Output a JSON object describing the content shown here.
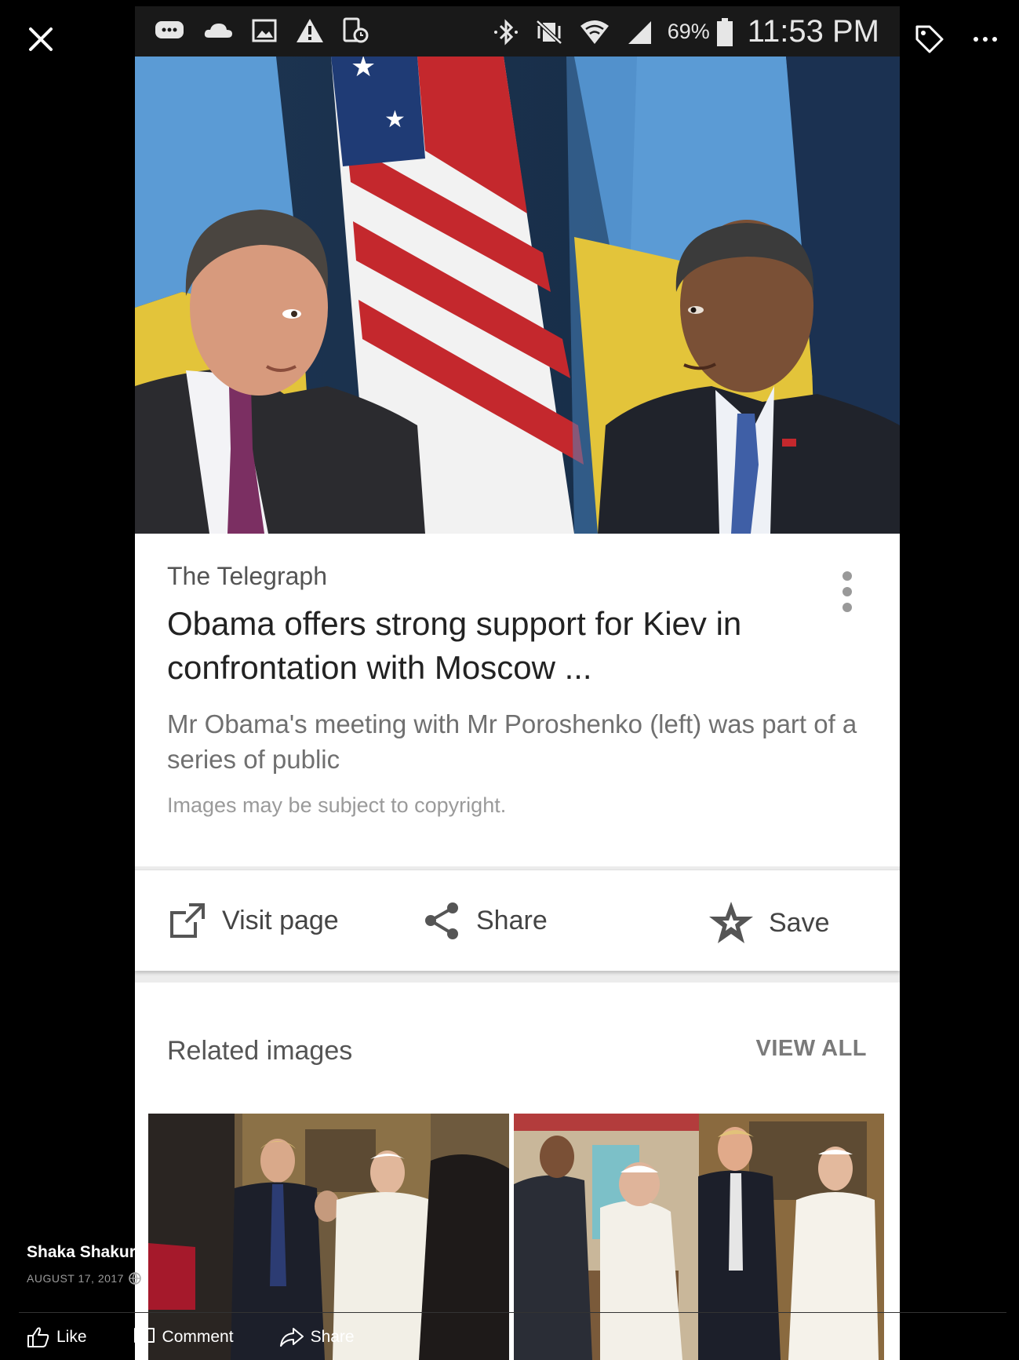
{
  "status_bar": {
    "battery_percent": "69%",
    "time": "11:53 PM"
  },
  "article": {
    "source": "The Telegraph",
    "headline": "Obama offers strong support for Kiev in confrontation with Moscow ...",
    "snippet": "Mr Obama's meeting with Mr Poroshenko (left) was part of a series of public",
    "copyright_note": "Images may be subject to copyright."
  },
  "actions": {
    "visit_label": "Visit page",
    "share_label": "Share",
    "save_label": "Save"
  },
  "related": {
    "title": "Related images",
    "view_all": "VIEW ALL"
  },
  "facebook": {
    "author": "Shaka Shakur",
    "date": "AUGUST 17, 2017",
    "like_label": "Like",
    "comment_label": "Comment",
    "share_label": "Share"
  },
  "colors": {
    "background": "#000000",
    "status_bar": "#191919",
    "card": "#ffffff",
    "headline_text": "#222222",
    "muted_text": "#707070"
  },
  "icons": [
    "close-icon",
    "tag-icon",
    "more-icon",
    "external-link-icon",
    "share-icon",
    "save-star-icon",
    "like-icon",
    "comment-icon",
    "share-arrow-icon",
    "globe-icon"
  ]
}
